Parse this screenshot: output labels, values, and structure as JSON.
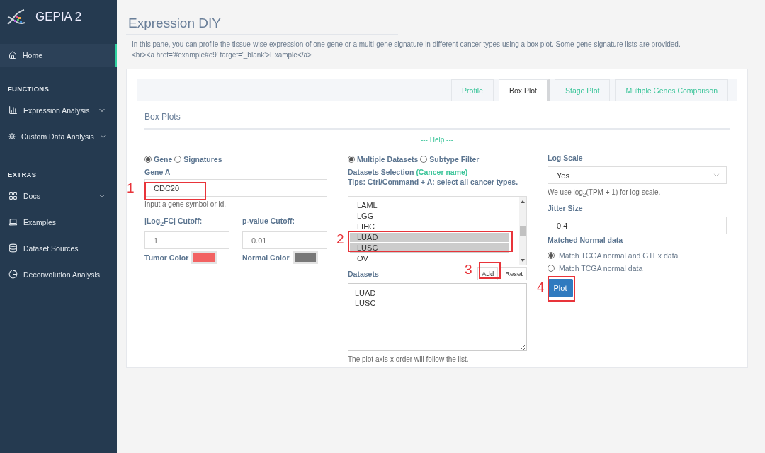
{
  "sidebar": {
    "brand": "GEPIA 2",
    "home": {
      "label": "Home",
      "selected": true
    },
    "sections": [
      {
        "heading": "FUNCTIONS",
        "items": [
          {
            "label": "Expression Analysis",
            "expandable": true,
            "selected": false
          },
          {
            "label": "Custom Data Analysis",
            "expandable": true,
            "selected": false
          }
        ]
      },
      {
        "heading": "EXTRAS",
        "items": [
          {
            "label": "Docs",
            "expandable": true,
            "selected": false
          },
          {
            "label": "Examples",
            "expandable": false,
            "selected": false
          },
          {
            "label": "Dataset Sources",
            "expandable": false,
            "selected": false
          },
          {
            "label": "Deconvolution Analysis",
            "expandable": false,
            "selected": false
          }
        ]
      }
    ]
  },
  "page": {
    "title": "Expression DIY",
    "description": "In this pane, you can profile the tissue-wise expression of one gene or a multi-gene signature in different cancer types using a box plot. Some gene signature lists are provided.",
    "description_2": "<br><a href='#example#e9' target='_blank'>Example</a>"
  },
  "tabs": [
    {
      "label": "Profile",
      "selected": false
    },
    {
      "label": "Box Plot",
      "selected": true
    },
    {
      "label": "Stage Plot",
      "selected": false
    },
    {
      "label": "Multiple Genes Comparison",
      "selected": false
    }
  ],
  "panel": {
    "title": "Box Plots",
    "help": "--- Help ---"
  },
  "gene_mode": [
    {
      "label": "Gene",
      "selected": true
    },
    {
      "label": "Signatures",
      "selected": false
    }
  ],
  "gene": {
    "label": "Gene A",
    "value": "CDC20",
    "hint": "Input a gene symbol or id."
  },
  "log2fc": {
    "label": "|Log$_{2}$FC| Cutoff:",
    "placeholder": "1"
  },
  "pvalue": {
    "label": "p-value Cutoff:",
    "placeholder": "0.01"
  },
  "tumor_color": {
    "label": "Tumor Color",
    "color": "#f26262"
  },
  "normal_color": {
    "label": "Normal Color",
    "color": "#787878"
  },
  "dataset_mode": [
    {
      "label": "Multiple Datasets",
      "selected": true
    },
    {
      "label": "Subtype Filter",
      "selected": false
    }
  ],
  "selection": {
    "label": "Datasets Selection",
    "note": "(Cancer name)",
    "tips": "Tips: Ctrl/Command + A: select all cancer types."
  },
  "cancer_list": [
    {
      "label": "LAML",
      "selected": false
    },
    {
      "label": "LGG",
      "selected": false
    },
    {
      "label": "LIHC",
      "selected": false
    },
    {
      "label": "LUAD",
      "selected": true
    },
    {
      "label": "LUSC",
      "selected": true
    },
    {
      "label": "OV",
      "selected": false
    }
  ],
  "datasets": {
    "label": "Datasets",
    "add": "Add",
    "reset": "Reset",
    "value": "LUAD\nLUSC",
    "note": "The plot axis-x order will follow the list."
  },
  "log_scale": {
    "label": "Log Scale",
    "value": "Yes",
    "hint": "We use log$_{2}$(TPM + 1) for log-scale."
  },
  "jitter": {
    "label": "Jitter Size",
    "value": "0.4"
  },
  "matched": {
    "label": "Matched Normal data",
    "options": [
      {
        "label": "Match TCGA normal and GTEx data",
        "selected": true
      },
      {
        "label": "Match TCGA normal data",
        "selected": false
      }
    ]
  },
  "plot_button": "Plot",
  "annotations": [
    {
      "number": "1"
    },
    {
      "number": "2"
    },
    {
      "number": "3"
    },
    {
      "number": "4"
    }
  ]
}
